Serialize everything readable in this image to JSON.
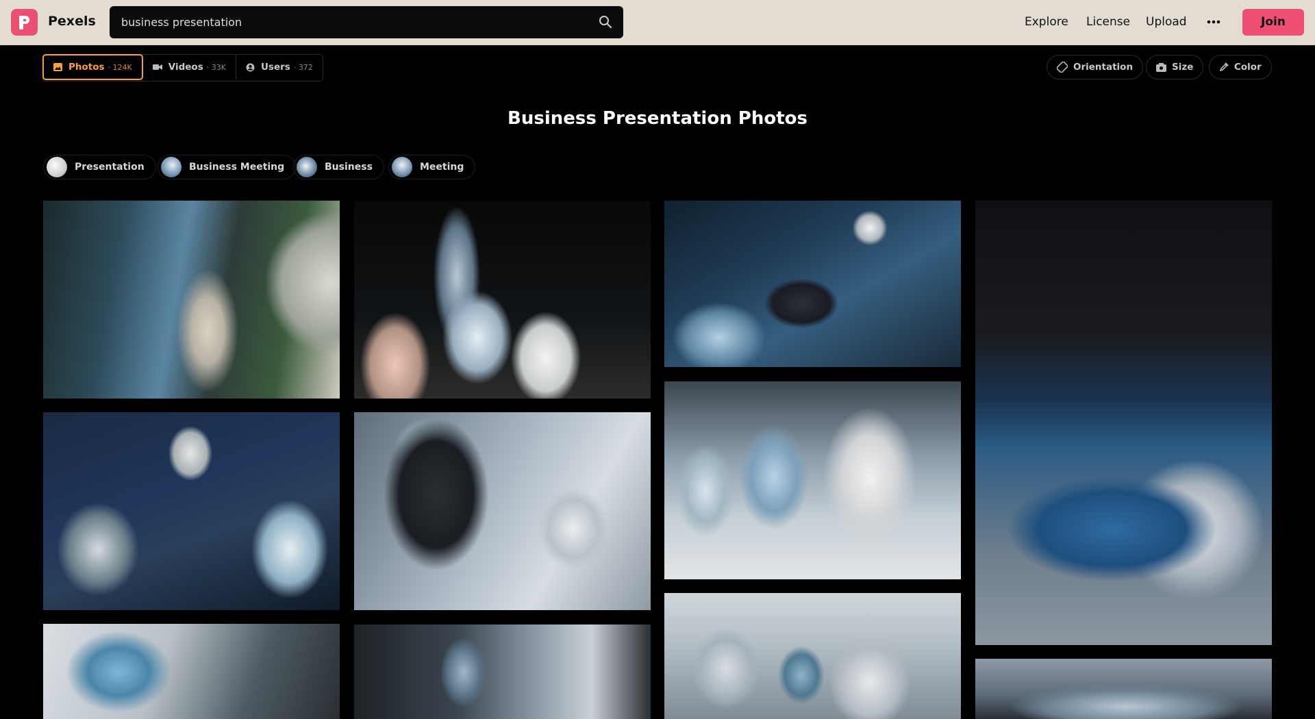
{
  "header": {
    "brand": "Pexels",
    "search_value": "business presentation",
    "nav": [
      "Explore",
      "License",
      "Upload"
    ],
    "join_label": "Join"
  },
  "tabs": [
    {
      "label": "Photos",
      "count": "124K",
      "icon": "photo-icon",
      "active": true
    },
    {
      "label": "Videos",
      "count": "33K",
      "icon": "video-icon",
      "active": false
    },
    {
      "label": "Users",
      "count": "372",
      "icon": "user-icon",
      "active": false
    }
  ],
  "filters": [
    "Orientation",
    "Size",
    "Color"
  ],
  "page_title": "Business Presentation Photos",
  "related": [
    "Presentation",
    "Business Meeting",
    "Business",
    "Meeting"
  ],
  "colors": {
    "brand": "#ed4e74",
    "active_tab": "#f6a13c",
    "topbar": "#e2dcd3"
  }
}
